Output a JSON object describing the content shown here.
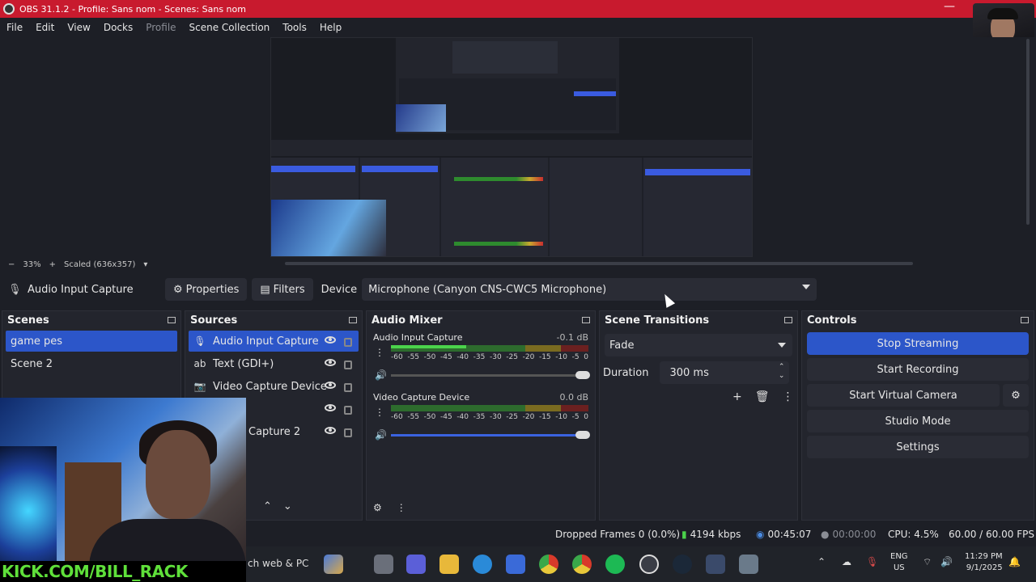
{
  "window": {
    "title": "OBS 31.1.2 - Profile: Sans nom - Scenes: Sans nom"
  },
  "menu": [
    "File",
    "Edit",
    "View",
    "Docks",
    "Profile",
    "Scene Collection",
    "Tools",
    "Help"
  ],
  "zoom": {
    "level": "33%",
    "scale": "Scaled (636x357)"
  },
  "properties_bar": {
    "source_name": "Audio Input Capture",
    "properties_label": "Properties",
    "filters_label": "Filters",
    "device_label": "Device",
    "device_value": "Microphone (Canyon CNS-CWC5 Microphone)"
  },
  "scenes": {
    "title": "Scenes",
    "items": [
      "game pes",
      "Scene 2"
    ]
  },
  "sources": {
    "title": "Sources",
    "items": [
      {
        "name": "Audio Input Capture",
        "icon": "microphone-icon"
      },
      {
        "name": "Text (GDI+)",
        "icon": "text-icon"
      },
      {
        "name": "Video Capture Device",
        "icon": "camera-icon"
      },
      {
        "name": "",
        "icon": ""
      },
      {
        "name": "Capture 2",
        "icon": ""
      }
    ]
  },
  "mixer": {
    "title": "Audio Mixer",
    "ticks": [
      "-60",
      "-55",
      "-50",
      "-45",
      "-40",
      "-35",
      "-30",
      "-25",
      "-20",
      "-15",
      "-10",
      "-5",
      "0"
    ],
    "channels": [
      {
        "name": "Audio Input Capture",
        "db": "-0.1 dB",
        "level": 0.38,
        "volume": 1.0
      },
      {
        "name": "Video Capture Device",
        "db": "0.0 dB",
        "level": 0.0,
        "volume": 1.0
      }
    ]
  },
  "transitions": {
    "title": "Scene Transitions",
    "type": "Fade",
    "duration_label": "Duration",
    "duration_value": "300 ms"
  },
  "controls": {
    "title": "Controls",
    "stop_streaming": "Stop Streaming",
    "start_recording": "Start Recording",
    "start_virtual_camera": "Start Virtual Camera",
    "studio_mode": "Studio Mode",
    "settings": "Settings"
  },
  "status": {
    "dropped_frames": "Dropped Frames 0 (0.0%)",
    "bitrate": "4194 kbps",
    "stream_time": "00:45:07",
    "record_time": "00:00:00",
    "cpu": "CPU: 4.5%",
    "fps": "60.00 / 60.00 FPS"
  },
  "taskbar": {
    "search_text": "ch web & PC",
    "language": "ENG",
    "region": "US",
    "time": "11:29 PM",
    "date": "9/1/2025"
  },
  "overlay": {
    "banner": "KICK.COM/BILL_RACK"
  },
  "colors": {
    "accent": "#2c56c9",
    "title_bar": "#c81a2e",
    "banner_text": "#5fe03a"
  }
}
